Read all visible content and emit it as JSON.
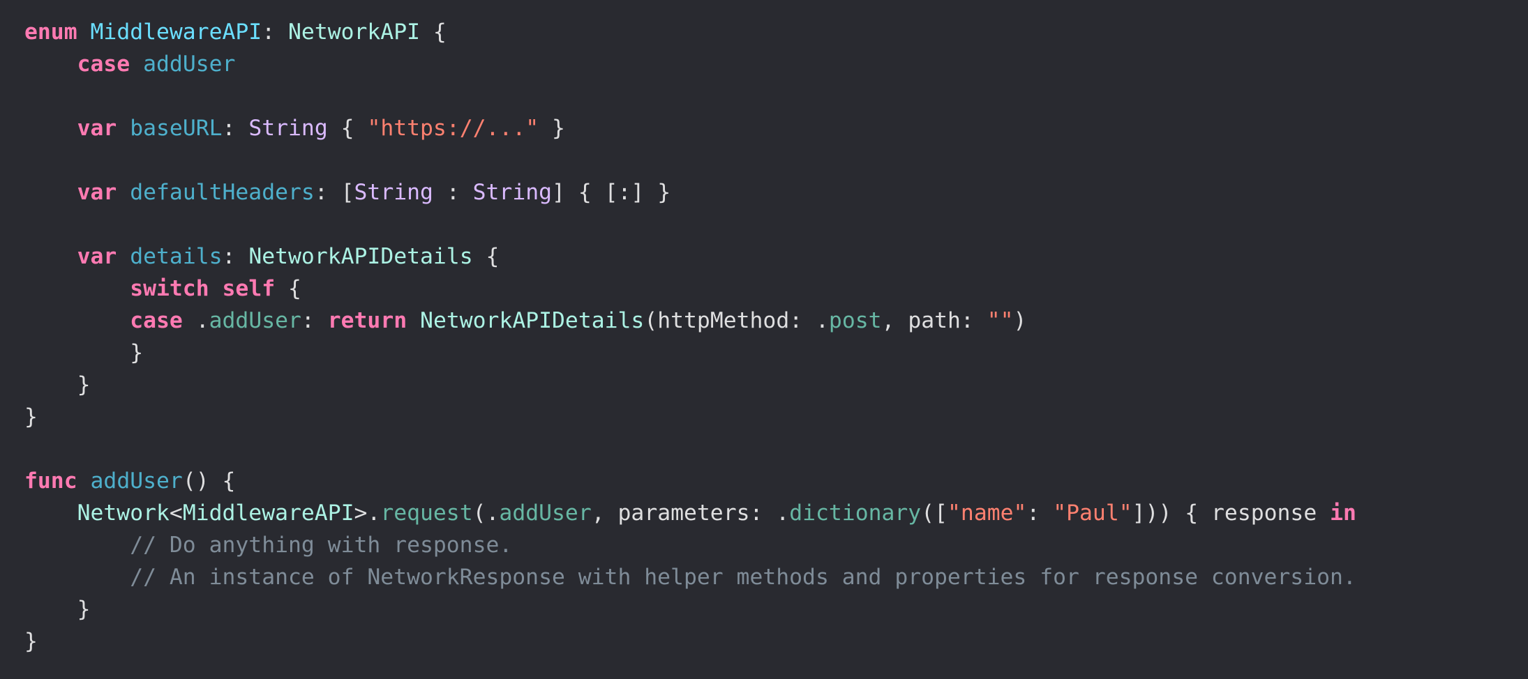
{
  "editor": {
    "theme": {
      "background": "#292a30",
      "plain": "#dfdfe0",
      "keyword": "#ff7ab2",
      "type_declaration": "#6bdfff",
      "project_type": "#acf2e4",
      "system_type": "#dabaff",
      "member": "#67b7a4",
      "declaration": "#4eb0cc",
      "string": "#ff8170",
      "comment": "#7f8c98"
    },
    "lines": [
      [
        {
          "t": "enum",
          "c": "kw"
        },
        {
          "t": " ",
          "c": "plain"
        },
        {
          "t": "MiddlewareAPI",
          "c": "typedecl"
        },
        {
          "t": ": ",
          "c": "plain"
        },
        {
          "t": "NetworkAPI",
          "c": "type"
        },
        {
          "t": " {",
          "c": "plain"
        }
      ],
      [
        {
          "t": "    ",
          "c": "plain"
        },
        {
          "t": "case",
          "c": "kw"
        },
        {
          "t": " ",
          "c": "plain"
        },
        {
          "t": "addUser",
          "c": "ident"
        }
      ],
      [],
      [
        {
          "t": "    ",
          "c": "plain"
        },
        {
          "t": "var",
          "c": "kw"
        },
        {
          "t": " ",
          "c": "plain"
        },
        {
          "t": "baseURL",
          "c": "ident"
        },
        {
          "t": ": ",
          "c": "plain"
        },
        {
          "t": "String",
          "c": "systype"
        },
        {
          "t": " { ",
          "c": "plain"
        },
        {
          "t": "\"https://...\"",
          "c": "str"
        },
        {
          "t": " }",
          "c": "plain"
        }
      ],
      [],
      [
        {
          "t": "    ",
          "c": "plain"
        },
        {
          "t": "var",
          "c": "kw"
        },
        {
          "t": " ",
          "c": "plain"
        },
        {
          "t": "defaultHeaders",
          "c": "ident"
        },
        {
          "t": ": [",
          "c": "plain"
        },
        {
          "t": "String",
          "c": "systype"
        },
        {
          "t": " : ",
          "c": "plain"
        },
        {
          "t": "String",
          "c": "systype"
        },
        {
          "t": "] { [:] }",
          "c": "plain"
        }
      ],
      [],
      [
        {
          "t": "    ",
          "c": "plain"
        },
        {
          "t": "var",
          "c": "kw"
        },
        {
          "t": " ",
          "c": "plain"
        },
        {
          "t": "details",
          "c": "ident"
        },
        {
          "t": ": ",
          "c": "plain"
        },
        {
          "t": "NetworkAPIDetails",
          "c": "type"
        },
        {
          "t": " {",
          "c": "plain"
        }
      ],
      [
        {
          "t": "        ",
          "c": "plain"
        },
        {
          "t": "switch",
          "c": "kw"
        },
        {
          "t": " ",
          "c": "plain"
        },
        {
          "t": "self",
          "c": "kw"
        },
        {
          "t": " {",
          "c": "plain"
        }
      ],
      [
        {
          "t": "        ",
          "c": "plain"
        },
        {
          "t": "case",
          "c": "kw"
        },
        {
          "t": " .",
          "c": "plain"
        },
        {
          "t": "addUser",
          "c": "prop"
        },
        {
          "t": ": ",
          "c": "plain"
        },
        {
          "t": "return",
          "c": "kw"
        },
        {
          "t": " ",
          "c": "plain"
        },
        {
          "t": "NetworkAPIDetails",
          "c": "type"
        },
        {
          "t": "(httpMethod: .",
          "c": "plain"
        },
        {
          "t": "post",
          "c": "prop"
        },
        {
          "t": ", path: ",
          "c": "plain"
        },
        {
          "t": "\"\"",
          "c": "str"
        },
        {
          "t": ")",
          "c": "plain"
        }
      ],
      [
        {
          "t": "        }",
          "c": "plain"
        }
      ],
      [
        {
          "t": "    }",
          "c": "plain"
        }
      ],
      [
        {
          "t": "}",
          "c": "plain"
        }
      ],
      [],
      [
        {
          "t": "func",
          "c": "kw"
        },
        {
          "t": " ",
          "c": "plain"
        },
        {
          "t": "addUser",
          "c": "ident"
        },
        {
          "t": "() {",
          "c": "plain"
        }
      ],
      [
        {
          "t": "    ",
          "c": "plain"
        },
        {
          "t": "Network",
          "c": "type"
        },
        {
          "t": "<",
          "c": "plain"
        },
        {
          "t": "MiddlewareAPI",
          "c": "type"
        },
        {
          "t": ">.",
          "c": "plain"
        },
        {
          "t": "request",
          "c": "prop"
        },
        {
          "t": "(.",
          "c": "plain"
        },
        {
          "t": "addUser",
          "c": "prop"
        },
        {
          "t": ", parameters: .",
          "c": "plain"
        },
        {
          "t": "dictionary",
          "c": "prop"
        },
        {
          "t": "([",
          "c": "plain"
        },
        {
          "t": "\"name\"",
          "c": "str"
        },
        {
          "t": ": ",
          "c": "plain"
        },
        {
          "t": "\"Paul\"",
          "c": "str"
        },
        {
          "t": "])) { response ",
          "c": "plain"
        },
        {
          "t": "in",
          "c": "kw"
        }
      ],
      [
        {
          "t": "        ",
          "c": "plain"
        },
        {
          "t": "// Do anything with response.",
          "c": "cm"
        }
      ],
      [
        {
          "t": "        ",
          "c": "plain"
        },
        {
          "t": "// An instance of NetworkResponse with helper methods and properties for response conversion.",
          "c": "cm"
        }
      ],
      [
        {
          "t": "    }",
          "c": "plain"
        }
      ],
      [
        {
          "t": "}",
          "c": "plain"
        }
      ]
    ]
  }
}
